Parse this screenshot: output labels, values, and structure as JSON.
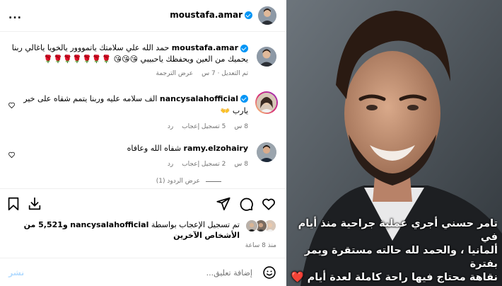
{
  "post": {
    "author": "moustafa.amar",
    "more_label": "..."
  },
  "caption": {
    "username": "moustafa.amar",
    "text_line1": "حمد الله علي سلامتك ياتمووور يالخويا ياغالي ربنا",
    "text_line2": "يحميك من العين ويحفظك ياحبيبي 😘😘😘 🌹🌹🌹🌹🌹🌹🌹",
    "edited": "تم التعديل · 7 س",
    "see_translation": "عرض الترجمة"
  },
  "comments": [
    {
      "username": "nancysalahofficial",
      "text_line1": "الف سلامه عليه وربنا يتمم شقاه على خير",
      "text_line2": "يارب 👐",
      "time": "8 س",
      "likes": "5 تسجيل إعجاب",
      "reply": "رد"
    },
    {
      "username": "ramy.elzohairy",
      "text_line1": "شفاه الله وعافاه",
      "time": "8 س",
      "likes": "2 تسجيل إعجاب",
      "reply": "رد"
    }
  ],
  "view_replies": "عرض الردود (1)",
  "likes_summary": {
    "prefix": "تم تسجيل الإعجاب بواسطة",
    "user": "nancysalahofficial",
    "rest": "و5,521 من الأشخاص",
    "rest_line2": "الآخرين"
  },
  "posted_time": "منذ 8 ساعة",
  "comment_input": {
    "placeholder": "إضافة تعليق...",
    "post_label": "نشر"
  },
  "photo": {
    "overlay_text_line1": "تامر حسني أجري عملية جراحية منذ أيام في",
    "overlay_text_line2": "ألمانيا ، والحمد لله حالته مستقرة ويمر بفترة",
    "overlay_text_line3": "نقاهة محتاج فيها راحة كاملة لعدة أيام ❤️"
  },
  "icons": {
    "verified": "verified-badge-icon",
    "like": "heart-icon",
    "comment": "comment-icon",
    "share": "share-icon",
    "save": "bookmark-icon",
    "download": "download-icon",
    "emoji": "emoji-icon",
    "more": "more-icon"
  },
  "colors": {
    "verified": "#0095f6",
    "muted": "#737373",
    "post_button": "#b3dbff"
  }
}
